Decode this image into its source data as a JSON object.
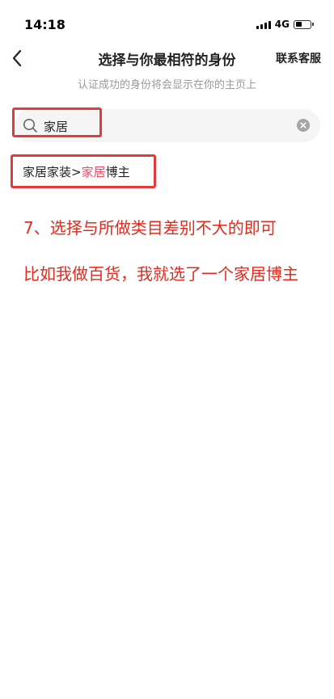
{
  "status_bar": {
    "time": "14:18",
    "network": "4G"
  },
  "nav": {
    "back_icon": "chevron-left-icon",
    "title": "选择与你最相符的身份",
    "contact_label": "联系客服"
  },
  "subtitle": "认证成功的身份将会显示在你的主页上",
  "search": {
    "icon": "search-icon",
    "value": "家居",
    "clear_icon": "clear-icon"
  },
  "result": {
    "prefix": "家居家装>",
    "highlight": "家居",
    "suffix": "博主"
  },
  "annotations": {
    "line1": "7、选择与所做类目差别不大的即可",
    "line2": "比如我做百货，我就选了一个家居博主",
    "color": "#e42a1d"
  },
  "colors": {
    "highlight": "#f04a63",
    "annotation_box": "#e23b3b"
  }
}
